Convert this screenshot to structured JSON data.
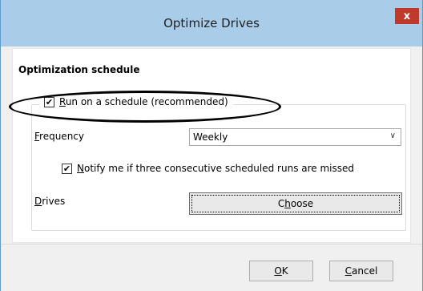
{
  "window": {
    "title": "Optimize Drives",
    "close_label": "x"
  },
  "schedule": {
    "section_title": "Optimization schedule",
    "run_checkbox_checked": true,
    "run_label_prefix": "R",
    "run_label_rest": "un on a schedule (recommended)",
    "frequency_label_prefix": "F",
    "frequency_label_rest": "requency",
    "frequency_value": "Weekly",
    "notify_checked": true,
    "notify_label_prefix": "N",
    "notify_label_rest": "otify me if three consecutive scheduled runs are missed",
    "drives_label_prefix": "D",
    "drives_label_rest": "rives",
    "choose_prefix": "C",
    "choose_underlined": "h",
    "choose_rest": "oose"
  },
  "buttons": {
    "ok_underlined": "O",
    "ok_rest": "K",
    "cancel_underlined": "C",
    "cancel_rest": "ancel"
  }
}
